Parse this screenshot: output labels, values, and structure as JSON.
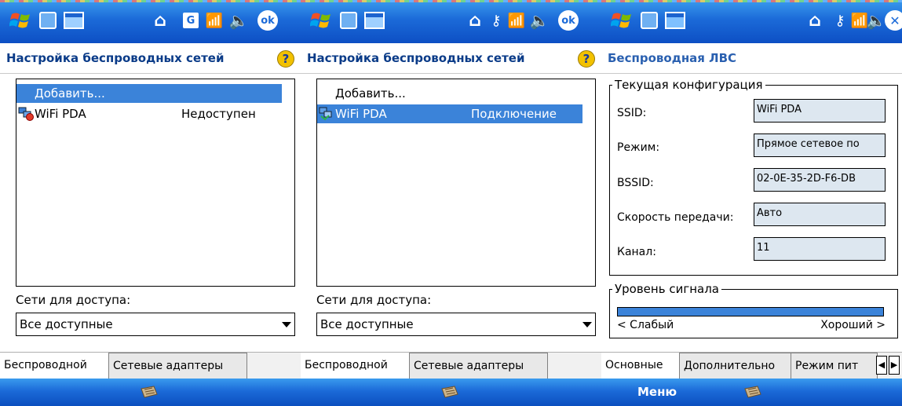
{
  "screen1": {
    "title": "Настройка беспроводных сетей",
    "list": {
      "add_item": "Добавить...",
      "network_name": "WiFi PDA",
      "network_status": "Недоступен"
    },
    "networks_caption": "Сети для доступа:",
    "networks_filter": "Все доступные",
    "tabs": [
      "Беспроводной",
      "Сетевые адаптеры"
    ]
  },
  "screen2": {
    "title": "Настройка беспроводных сетей",
    "list": {
      "add_item": "Добавить...",
      "network_name": "WiFi PDA",
      "network_status": "Подключение"
    },
    "networks_caption": "Сети для доступа:",
    "networks_filter": "Все доступные",
    "tabs": [
      "Беспроводной",
      "Сетевые адаптеры"
    ]
  },
  "screen3": {
    "title": "Беспроводная ЛВС",
    "config_group": "Текущая конфигурация",
    "fields": [
      {
        "label": "SSID:",
        "value": "WiFi PDA"
      },
      {
        "label": "Режим:",
        "value": "Прямое сетевое по"
      },
      {
        "label": "BSSID:",
        "value": "02-0E-35-2D-F6-DB"
      },
      {
        "label": "Скорость передачи:",
        "value": "Авто"
      },
      {
        "label": "Канал:",
        "value": "11"
      }
    ],
    "signal_group": "Уровень сигнала",
    "signal_level": 1.0,
    "signal_weak": "< Слабый",
    "signal_good": "Хороший >",
    "tabs": [
      "Основные",
      "Дополнительно",
      "Режим пит"
    ],
    "softkey_menu": "Меню"
  },
  "status_icons": {
    "ok_label": "ok",
    "g_label": "G"
  },
  "colors": {
    "bar_blue": "#1b6ad8",
    "selection": "#3b83d9",
    "title_blue": "#0a3b88",
    "field_bg": "#dde7f0"
  }
}
